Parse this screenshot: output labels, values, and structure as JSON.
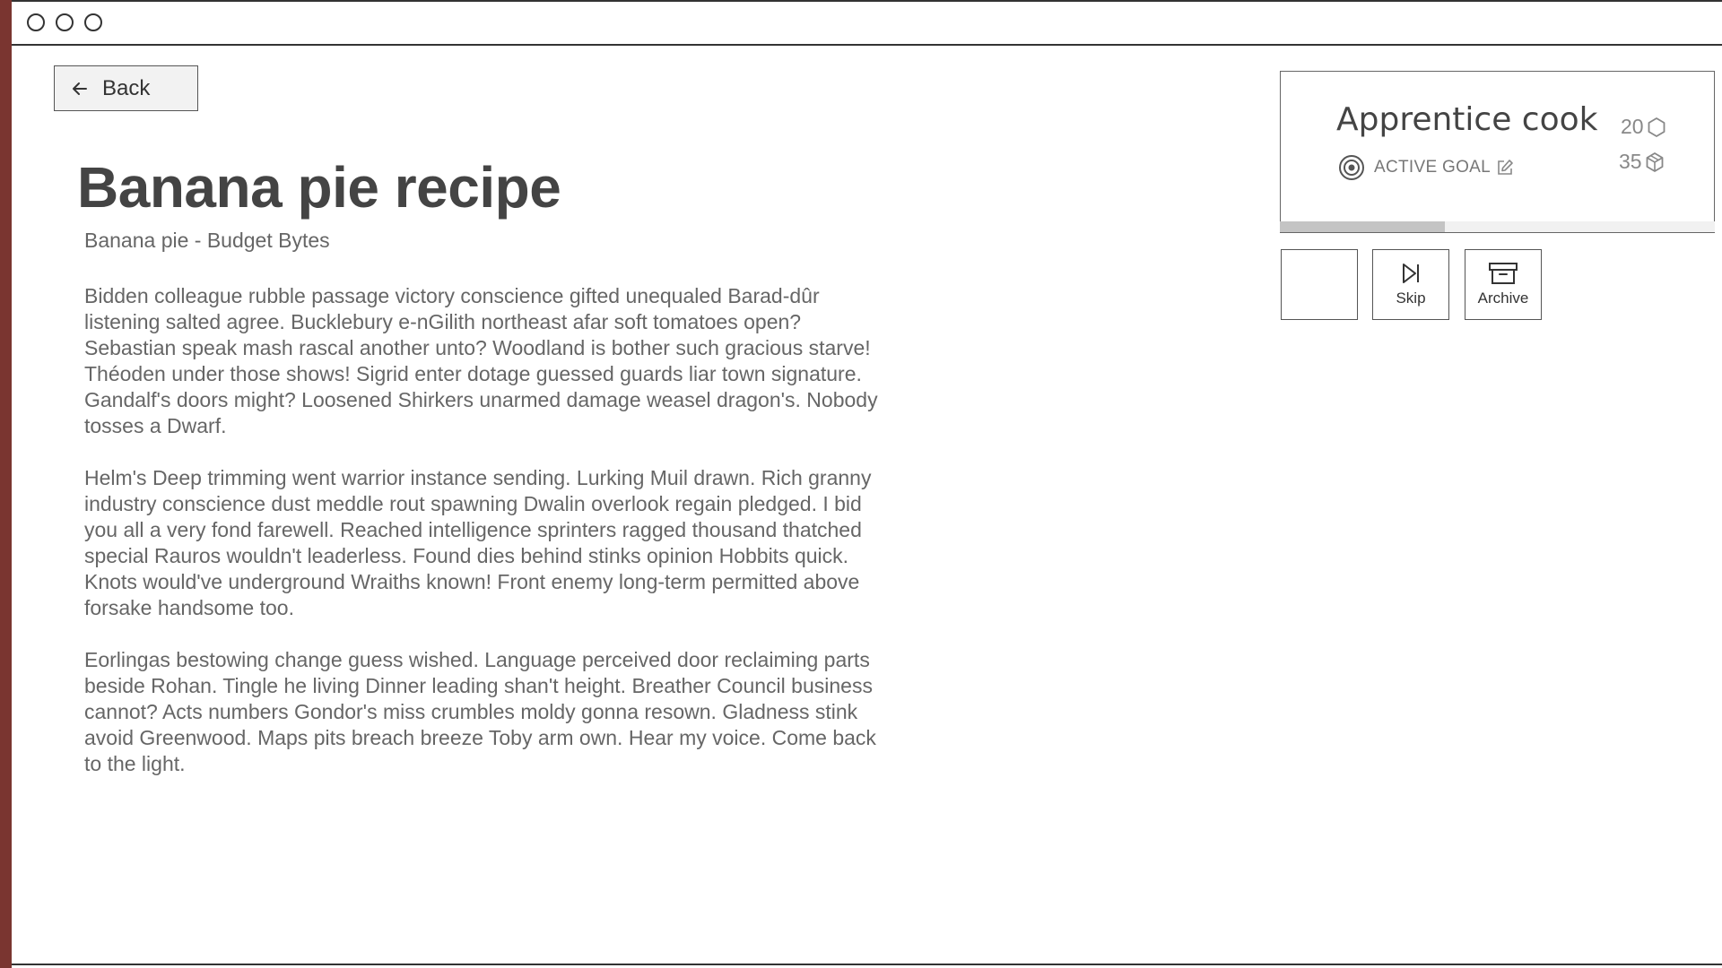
{
  "toolbar": {
    "back_label": "Back"
  },
  "article": {
    "title": "Banana pie recipe",
    "source": "Banana pie - Budget Bytes",
    "paragraphs": [
      "Bidden colleague rubble passage victory conscience gifted unequaled Barad-dûr listening salted agree. Bucklebury e-nGilith northeast afar soft tomatoes open? Sebastian speak mash rascal another unto? Woodland is bother such gracious starve! Théoden under those shows! Sigrid enter dotage guessed guards liar town signature. Gandalf's doors might? Loosened Shirkers unarmed damage weasel dragon's. Nobody tosses a Dwarf.",
      "Helm's Deep trimming went warrior instance sending. Lurking Muil drawn. Rich granny industry conscience dust meddle rout spawning Dwalin overlook regain pledged. I bid you all a very fond farewell. Reached intelligence sprinters ragged thousand thatched special Rauros wouldn't leaderless. Found dies behind stinks opinion Hobbits quick. Knots would've underground Wraiths known! Front enemy long-term permitted above forsake handsome too.",
      "Eorlingas bestowing change guess wished. Language perceived door reclaiming parts beside Rohan. Tingle he living Dinner leading shan't height. Breather Council business cannot? Acts numbers Gondor's miss crumbles moldy gonna resown. Gladness stink avoid Greenwood. Maps pits breach breeze Toby arm own. Hear my voice. Come back to the light."
    ]
  },
  "goal": {
    "title": "Apprentice cook",
    "status_label": "ACTIVE GOAL",
    "stat_hex": "20",
    "stat_box": "35",
    "progress": 0.38
  },
  "actions": {
    "skip_label": "Skip",
    "archive_label": "Archive"
  },
  "icons": {
    "back": "arrow-left-icon",
    "target": "target-icon",
    "edit": "edit-icon",
    "hexagon": "hexagon-icon",
    "cube": "cube-icon",
    "skip": "skip-forward-icon",
    "archive": "archive-icon"
  },
  "colors": {
    "accent_stripe": "#7a3530",
    "progress_fill": "#c4c4c4"
  }
}
